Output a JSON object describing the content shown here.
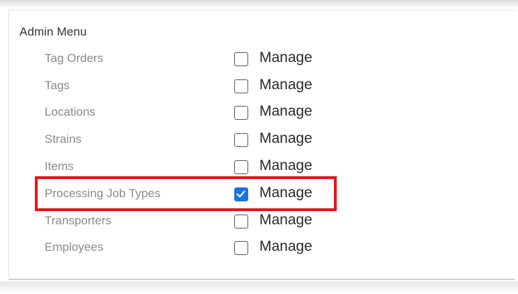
{
  "menu": {
    "title": "Admin Menu",
    "items": [
      {
        "label": "Tag Orders",
        "action": "Manage",
        "checked": false
      },
      {
        "label": "Tags",
        "action": "Manage",
        "checked": false
      },
      {
        "label": "Locations",
        "action": "Manage",
        "checked": false
      },
      {
        "label": "Strains",
        "action": "Manage",
        "checked": false
      },
      {
        "label": "Items",
        "action": "Manage",
        "checked": false
      },
      {
        "label": "Processing Job Types",
        "action": "Manage",
        "checked": true
      },
      {
        "label": "Transporters",
        "action": "Manage",
        "checked": false
      },
      {
        "label": "Employees",
        "action": "Manage",
        "checked": false
      }
    ]
  },
  "colors": {
    "checkbox_checked": "#1a73e8",
    "highlight_border": "#e8121a",
    "item_label": "#8a8a8a"
  },
  "icons": {
    "check": "checkmark-icon"
  }
}
